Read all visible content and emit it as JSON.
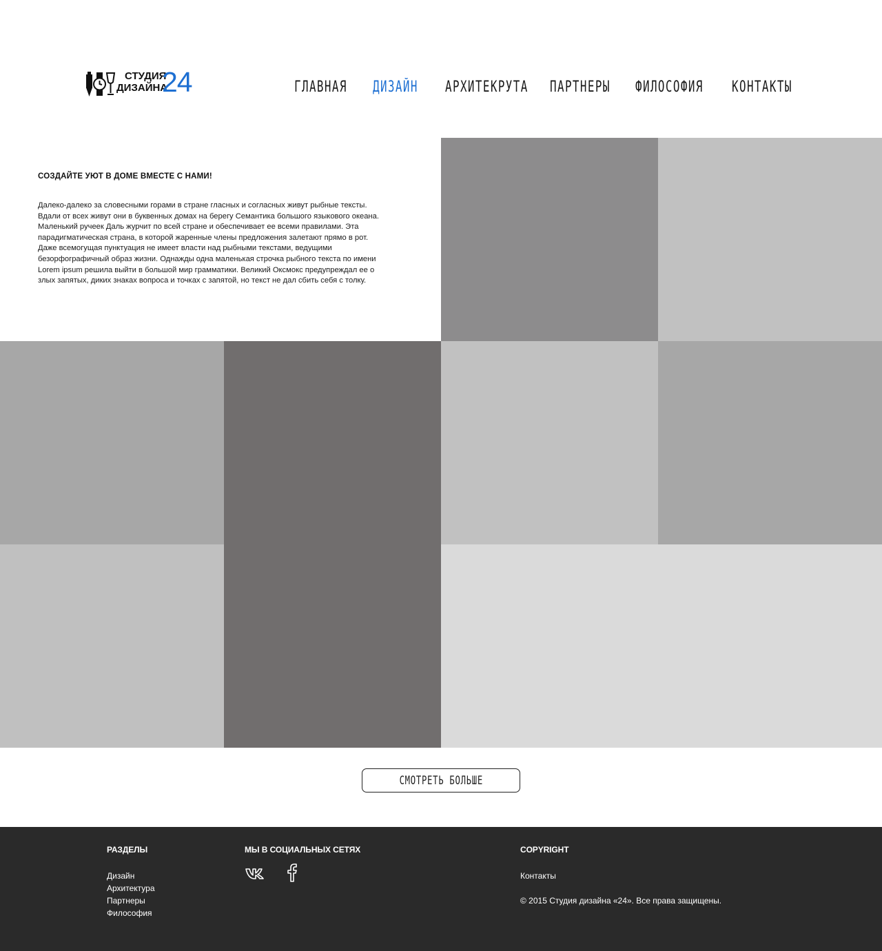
{
  "colors": {
    "accent": "#1d6fd2",
    "footer_bg": "#2a2a2a",
    "tiles": [
      "#8d8c8d",
      "#c1c1c1",
      "#a7a7a7",
      "#716e6e",
      "#c1c1c1",
      "#a7a7a7",
      "#c0c0c0",
      "#dadada"
    ]
  },
  "logo": {
    "line1": "СТУДИЯ",
    "line2": "ДИЗАЙНА",
    "number": "24",
    "icons": [
      "pen-icon",
      "watch-icon",
      "glass-icon"
    ]
  },
  "nav": {
    "items": [
      {
        "label": "главная",
        "active": false
      },
      {
        "label": "дизайн",
        "active": true
      },
      {
        "label": "архитекрута",
        "active": false
      },
      {
        "label": "партнеры",
        "active": false
      },
      {
        "label": "философия",
        "active": false
      },
      {
        "label": "контакты",
        "active": false
      }
    ]
  },
  "intro": {
    "title": "СОЗДАЙТЕ УЮТ В ДОМЕ ВМЕСТЕ С НАМИ!",
    "body": "Далеко-далеко за словесными горами в стране гласных и согласных живут рыбные тексты.\nВдали от всех живут они в буквенных домах на берегу Семантика большого языкового океана.\nМаленький ручеек Даль журчит по всей стране и обеспечивает ее всеми правилами. Эта\nпарадигматическая страна, в которой жаренные члены предложения залетают прямо в рот.\nДаже всемогущая пунктуация не имеет власти над рыбными текстами, ведущими\nбезорфографичный образ жизни. Однажды одна маленькая строчка рыбного текста по имени\nLorem ipsum решила выйти в большой мир грамматики. Великий Оксмокс предупреждал ее о\nзлых запятых, диких знаках вопроса и точках с запятой, но текст не дал сбить себя с толку."
  },
  "more_button": {
    "label": "смотреть больше"
  },
  "footer": {
    "sections": {
      "heading": "РАЗДЕЛЫ",
      "links": [
        "Дизайн",
        "Архитектура",
        "Партнеры",
        "Философия"
      ]
    },
    "social": {
      "heading": "МЫ В СОЦИАЛЬНЫХ СЕТЯХ",
      "icons": [
        "vk-icon",
        "facebook-icon"
      ]
    },
    "copyright": {
      "heading": "COPYRIGHT",
      "link": "Контакты",
      "text": "© 2015 Студия дизайна «24». Все права защищены."
    }
  }
}
